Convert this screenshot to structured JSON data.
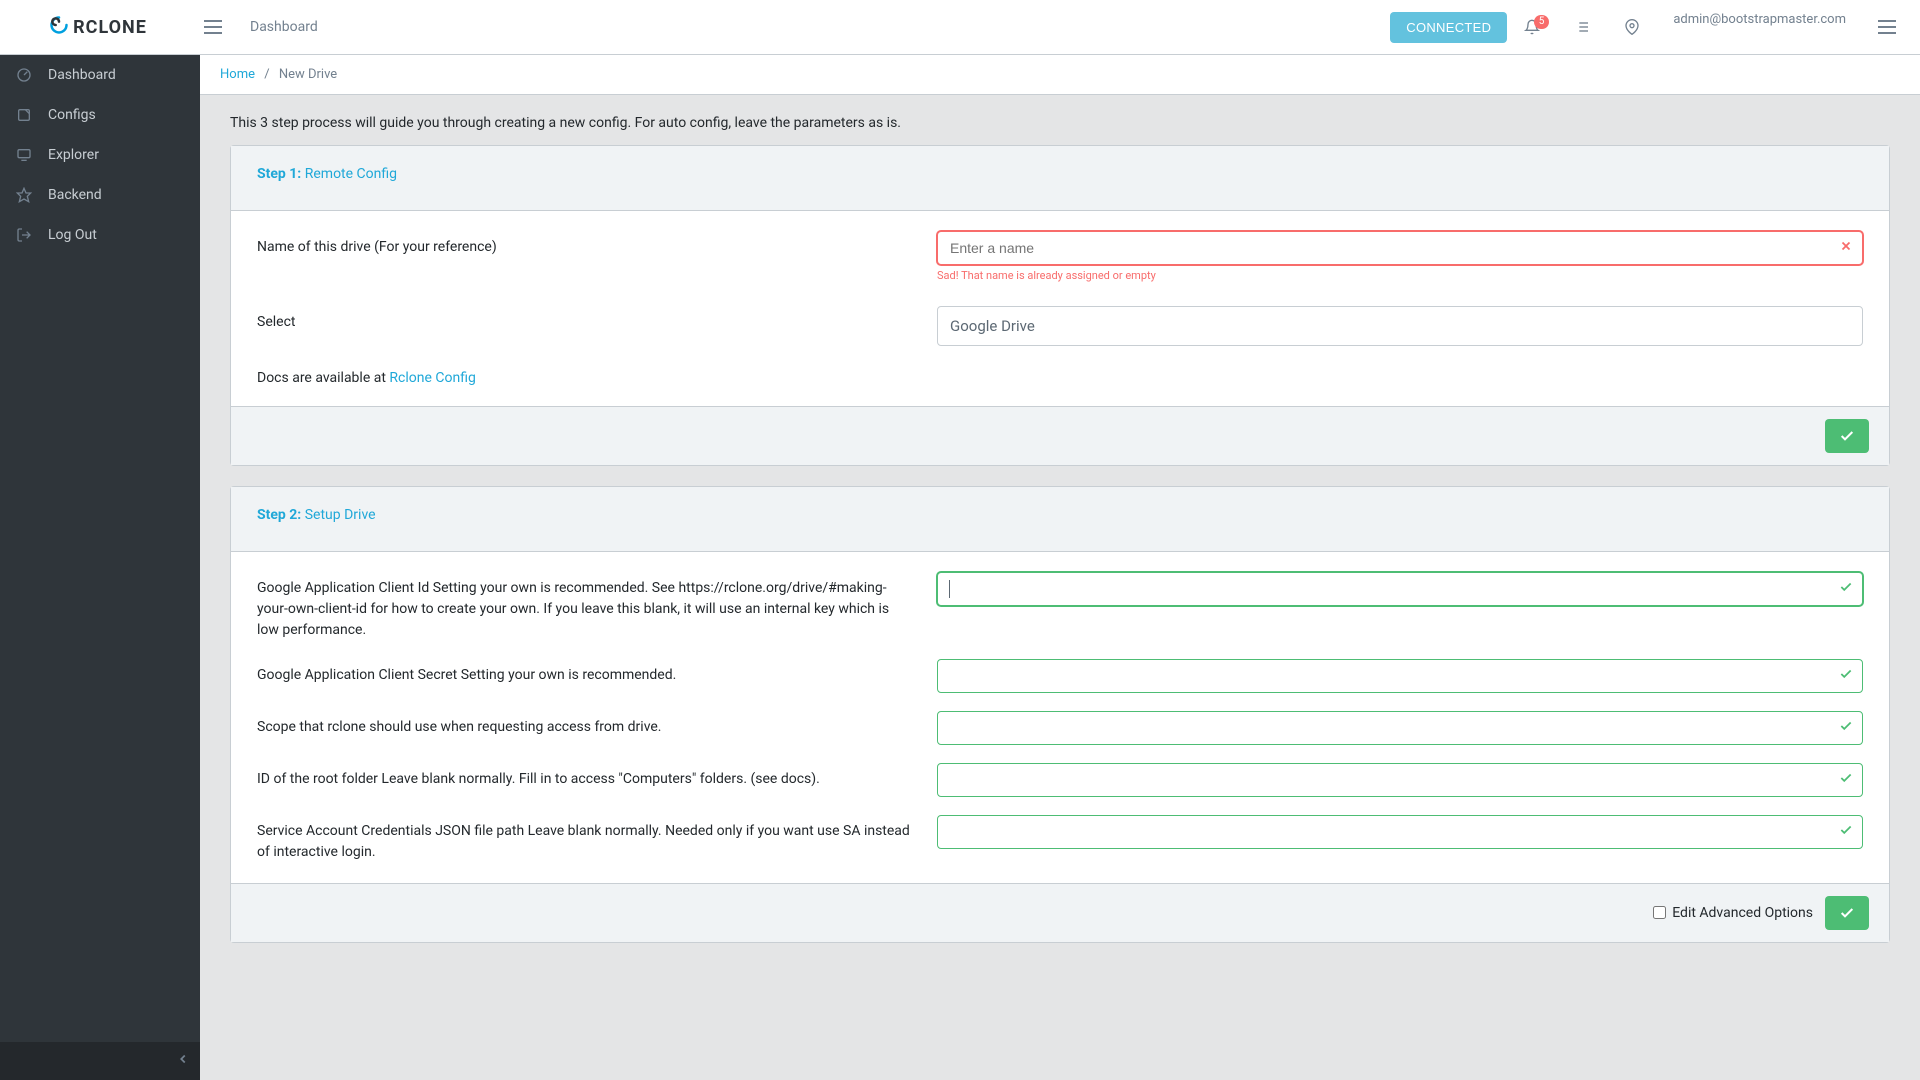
{
  "brand": "RCLONE",
  "header": {
    "nav_label": "Dashboard",
    "connected_label": "CONNECTED",
    "badge_count": "5",
    "user_email": "admin@bootstrapmaster.com"
  },
  "sidebar": {
    "items": [
      {
        "label": "Dashboard"
      },
      {
        "label": "Configs"
      },
      {
        "label": "Explorer"
      },
      {
        "label": "Backend"
      },
      {
        "label": "Log Out"
      }
    ]
  },
  "breadcrumb": {
    "home": "Home",
    "sep": "/",
    "current": "New Drive"
  },
  "intro": "This 3 step process will guide you through creating a new config. For auto config, leave the parameters as is.",
  "step1": {
    "num": "Step 1:",
    "label": "Remote Config",
    "name_label": "Name of this drive (For your reference)",
    "name_placeholder": "Enter a name",
    "name_error": "Sad! That name is already assigned or empty",
    "select_label": "Select",
    "select_value": "Google Drive",
    "docs_prefix": "Docs are available at ",
    "docs_link": "Rclone Config"
  },
  "step2": {
    "num": "Step 2:",
    "label": "Setup Drive",
    "fields": [
      {
        "label": "Google Application Client Id Setting your own is recommended. See https://rclone.org/drive/#making-your-own-client-id for how to create your own. If you leave this blank, it will use an internal key which is low performance.",
        "focused": true
      },
      {
        "label": "Google Application Client Secret Setting your own is recommended."
      },
      {
        "label": "Scope that rclone should use when requesting access from drive."
      },
      {
        "label": "ID of the root folder Leave blank normally. Fill in to access \"Computers\" folders. (see docs)."
      },
      {
        "label": "Service Account Credentials JSON file path Leave blank normally. Needed only if you want use SA instead of interactive login."
      }
    ],
    "adv_label": "Edit Advanced Options"
  }
}
